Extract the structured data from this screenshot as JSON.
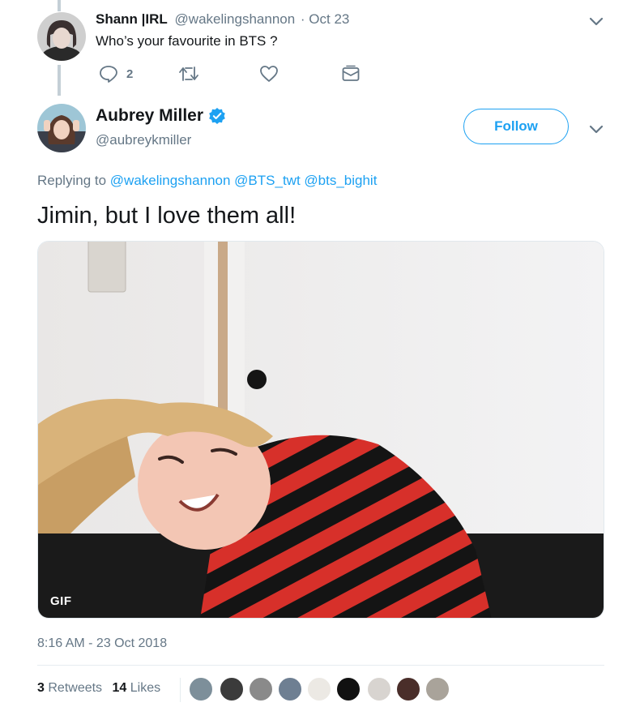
{
  "parent_tweet": {
    "display_name": "Shann |IRL",
    "handle": "@wakelingshannon",
    "date": "· Oct 23",
    "text": "Who’s your favourite in BTS ?",
    "reply_count": "2"
  },
  "reply_tweet": {
    "display_name": "Aubrey Miller",
    "handle": "@aubreykmiller",
    "follow_label": "Follow",
    "replying_prefix": "Replying to",
    "replying_to": [
      "@wakelingshannon",
      "@BTS_twt",
      "@bts_bighit"
    ],
    "text": "Jimin, but I love them all!",
    "media_badge": "GIF",
    "timestamp": "8:16 AM - 23 Oct 2018",
    "stats": {
      "retweets_count": "3",
      "retweets_label": "Retweets",
      "likes_count": "14",
      "likes_label": "Likes"
    }
  },
  "colors": {
    "accent": "#1da1f2",
    "muted": "#657786",
    "verified": "#1da1f2"
  },
  "icons": [
    "reply-icon",
    "retweet-icon",
    "like-icon",
    "message-icon",
    "chevron-down-icon",
    "verified-badge-icon"
  ]
}
